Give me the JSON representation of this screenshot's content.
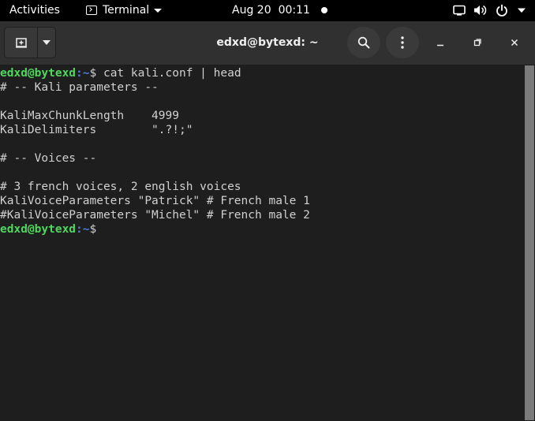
{
  "topbar": {
    "activities": "Activities",
    "app_menu": "Terminal",
    "date": "Aug 20",
    "time": "00:11",
    "icons": [
      "screen-icon",
      "volume-icon",
      "power-icon",
      "chevron-down-icon"
    ]
  },
  "window": {
    "title": "edxd@bytexd: ~",
    "icons": [
      "new-tab-icon",
      "menu-arrow-icon",
      "search-icon",
      "more-icon",
      "minimize-icon",
      "maximize-icon",
      "close-icon"
    ]
  },
  "terminal": {
    "prompt_user": "edxd@bytexd",
    "prompt_sep": ":",
    "prompt_path": "~",
    "prompt_symbol": "$ ",
    "command": "cat kali.conf | head",
    "output": [
      "# -- Kali parameters --",
      "",
      "KaliMaxChunkLength    4999",
      "KaliDelimiters        \".?!;\"",
      "",
      "# -- Voices --",
      "",
      "# 3 french voices, 2 english voices",
      "KaliVoiceParameters \"Patrick\" # French male 1",
      "#KaliVoiceParameters \"Michel\" # French male 2"
    ],
    "prompt_after": "$",
    "colors": {
      "user": "#4fd65e",
      "path": "#4a7fd8",
      "text": "#d0d0d0",
      "background": "#1e1e1e"
    }
  }
}
